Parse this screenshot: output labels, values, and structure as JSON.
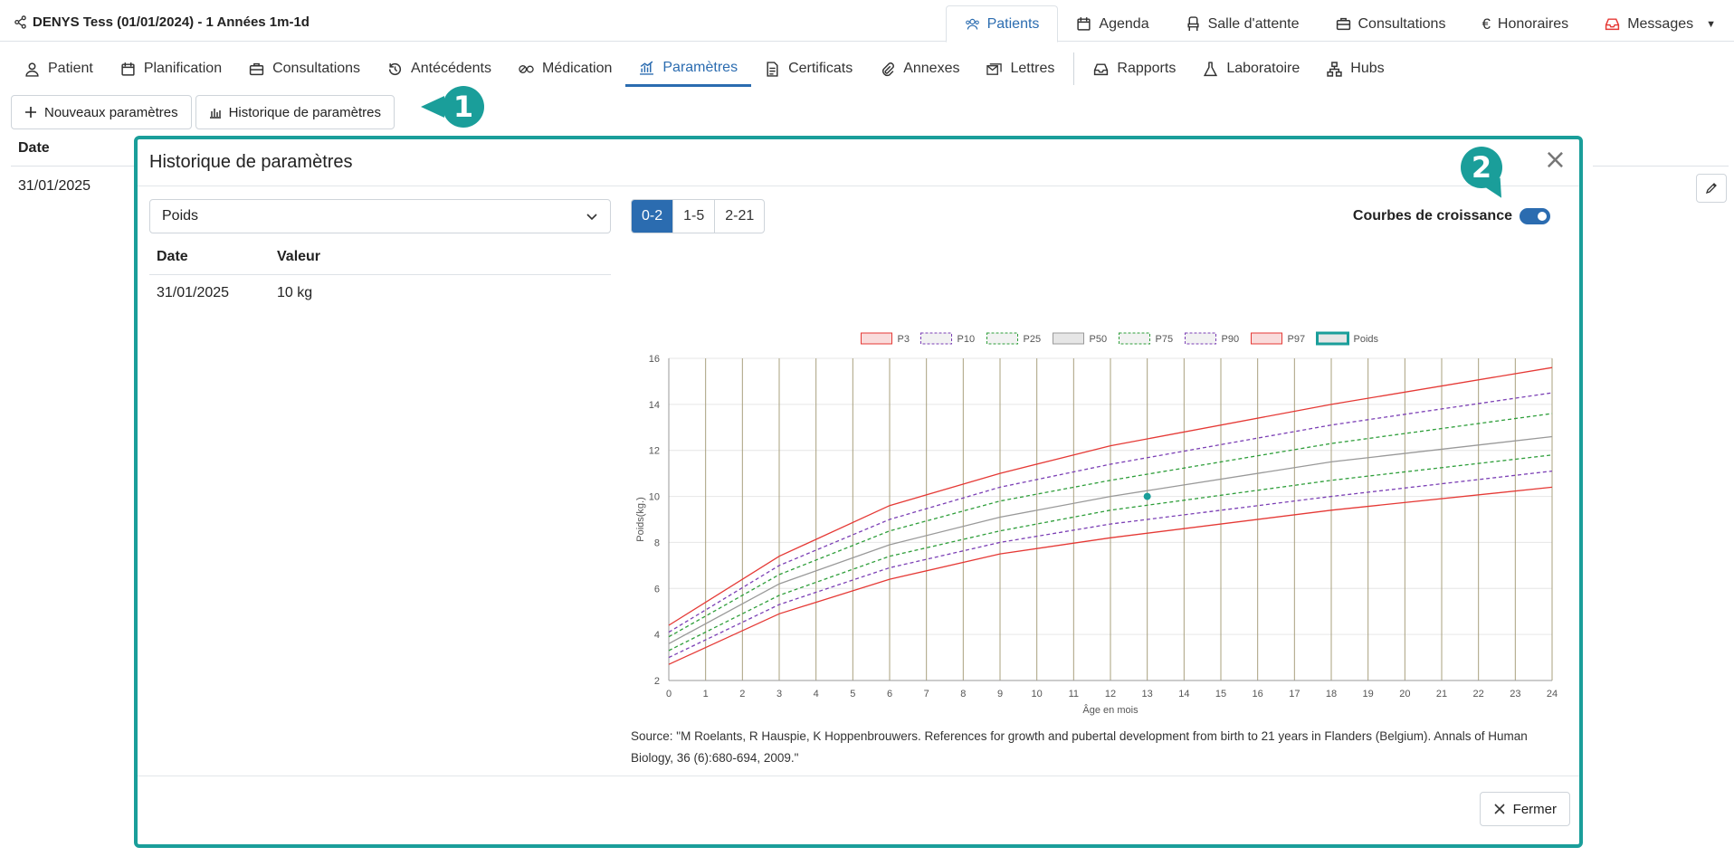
{
  "header": {
    "patient_title": "DENYS Tess (01/01/2024) - 1 Années 1m-1d",
    "nav": [
      {
        "label": "Patients",
        "icon": "users-icon",
        "active": true
      },
      {
        "label": "Agenda",
        "icon": "calendar-icon"
      },
      {
        "label": "Salle d'attente",
        "icon": "chair-icon"
      },
      {
        "label": "Consultations",
        "icon": "briefcase-icon"
      },
      {
        "label": "Honoraires",
        "icon": "euro-icon"
      },
      {
        "label": "Messages",
        "icon": "inbox-icon"
      }
    ]
  },
  "subnav": [
    {
      "label": "Patient",
      "icon": "user-icon"
    },
    {
      "label": "Planification",
      "icon": "calendar-icon"
    },
    {
      "label": "Consultations",
      "icon": "briefcase-icon"
    },
    {
      "label": "Antécédents",
      "icon": "history-icon"
    },
    {
      "label": "Médication",
      "icon": "pills-icon"
    },
    {
      "label": "Paramètres",
      "icon": "chart-icon",
      "active": true
    },
    {
      "label": "Certificats",
      "icon": "file-icon"
    },
    {
      "label": "Annexes",
      "icon": "paperclip-icon"
    },
    {
      "label": "Lettres",
      "icon": "letters-icon"
    },
    {
      "label": "Rapports",
      "icon": "inbox-icon"
    },
    {
      "label": "Laboratoire",
      "icon": "flask-icon"
    },
    {
      "label": "Hubs",
      "icon": "hub-icon"
    }
  ],
  "actions": {
    "new_params": "Nouveaux paramètres",
    "history": "Historique de paramètres"
  },
  "badges": {
    "one": "1",
    "two": "2"
  },
  "background_table": {
    "date_header": "Date",
    "date_value": "31/01/2025"
  },
  "modal": {
    "title": "Historique de paramètres",
    "close": "×",
    "select_value": "Poids",
    "table": {
      "headers": [
        "Date",
        "Valeur"
      ],
      "rows": [
        [
          "31/01/2025",
          "10 kg"
        ]
      ]
    },
    "ranges": [
      {
        "label": "0-2",
        "active": true
      },
      {
        "label": "1-5"
      },
      {
        "label": "2-21"
      }
    ],
    "growth_toggle_label": "Courbes de croissance",
    "growth_toggle_on": true,
    "source": "Source: \"M Roelants, R Hauspie, K Hoppenbrouwers. References for growth and pubertal development from birth to 21 years in Flanders (Belgium). Annals of Human Biology, 36 (6):680-694, 2009.\"",
    "close_button": "Fermer"
  },
  "chart_data": {
    "type": "line",
    "xlabel": "Âge en mois",
    "ylabel": "Poids(kg.)",
    "xlim": [
      0,
      24
    ],
    "ylim": [
      2,
      16
    ],
    "x_ticks": [
      0,
      1,
      2,
      3,
      4,
      5,
      6,
      7,
      8,
      9,
      10,
      11,
      12,
      13,
      14,
      15,
      16,
      17,
      18,
      19,
      20,
      21,
      22,
      23,
      24
    ],
    "y_ticks": [
      2,
      4,
      6,
      8,
      10,
      12,
      14,
      16
    ],
    "grid": true,
    "legend_position": "top",
    "x": [
      0,
      3,
      6,
      9,
      12,
      18,
      24
    ],
    "series": [
      {
        "name": "P3",
        "color": "#e53935",
        "dash": false,
        "values": [
          2.7,
          4.9,
          6.4,
          7.5,
          8.2,
          9.4,
          10.4
        ]
      },
      {
        "name": "P10",
        "color": "#7b3fb5",
        "dash": true,
        "values": [
          3.0,
          5.3,
          6.9,
          8.0,
          8.8,
          10.0,
          11.1
        ]
      },
      {
        "name": "P25",
        "color": "#2e9e3a",
        "dash": true,
        "values": [
          3.3,
          5.7,
          7.4,
          8.5,
          9.4,
          10.7,
          11.8
        ]
      },
      {
        "name": "P50",
        "color": "#999999",
        "dash": false,
        "values": [
          3.6,
          6.2,
          7.9,
          9.1,
          10.0,
          11.5,
          12.6
        ]
      },
      {
        "name": "P75",
        "color": "#2e9e3a",
        "dash": true,
        "values": [
          3.9,
          6.6,
          8.5,
          9.8,
          10.7,
          12.3,
          13.6
        ]
      },
      {
        "name": "P90",
        "color": "#7b3fb5",
        "dash": true,
        "values": [
          4.1,
          7.0,
          9.0,
          10.4,
          11.4,
          13.1,
          14.5
        ]
      },
      {
        "name": "P97",
        "color": "#e53935",
        "dash": false,
        "values": [
          4.4,
          7.4,
          9.6,
          11.0,
          12.2,
          14.0,
          15.6
        ]
      }
    ],
    "points": [
      {
        "name": "Poids",
        "x": 13,
        "y": 10,
        "color": "#1a9e9a"
      }
    ]
  }
}
